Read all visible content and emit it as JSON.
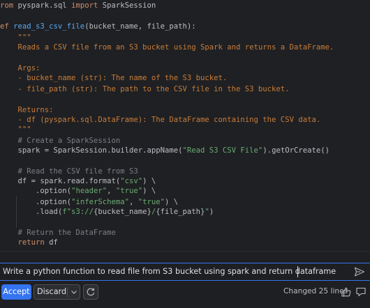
{
  "editor": {
    "lines": [
      [
        {
          "c": "kw",
          "t": "rom "
        },
        {
          "c": "id",
          "t": "pyspark.sql "
        },
        {
          "c": "kw",
          "t": "import "
        },
        {
          "c": "id",
          "t": "SparkSession"
        }
      ],
      [],
      [
        {
          "c": "kw",
          "t": "ef "
        },
        {
          "c": "fn",
          "t": "read_s3_csv_file"
        },
        {
          "c": "id",
          "t": "(bucket_name, file_path):"
        }
      ],
      [
        {
          "c": "doc",
          "t": "    \"\"\""
        }
      ],
      [
        {
          "c": "doc",
          "t": "    Reads a CSV file from an S3 bucket using Spark and returns a DataFrame."
        }
      ],
      [],
      [
        {
          "c": "doc",
          "t": "    Args:"
        }
      ],
      [
        {
          "c": "doc",
          "t": "    - bucket_name (str): The name of the S3 bucket."
        }
      ],
      [
        {
          "c": "doc",
          "t": "    - file_path (str): The path to the CSV file in the S3 bucket."
        }
      ],
      [],
      [
        {
          "c": "doc",
          "t": "    Returns:"
        }
      ],
      [
        {
          "c": "doc",
          "t": "    - df (pyspark.sql.DataFrame): The DataFrame containing the CSV data."
        }
      ],
      [
        {
          "c": "doc",
          "t": "    \"\"\""
        }
      ],
      [
        {
          "c": "cmt",
          "t": "    # Create a SparkSession"
        }
      ],
      [
        {
          "c": "id",
          "t": "    spark = SparkSession.builder.appName("
        },
        {
          "c": "str",
          "t": "\"Read S3 CSV File\""
        },
        {
          "c": "id",
          "t": ").getOrCreate()"
        }
      ],
      [],
      [
        {
          "c": "cmt",
          "t": "    # Read the CSV file from S3"
        }
      ],
      [
        {
          "c": "id",
          "t": "    df = spark.read.format("
        },
        {
          "c": "str",
          "t": "\"csv\""
        },
        {
          "c": "id",
          "t": ") \\"
        }
      ],
      [
        {
          "c": "id",
          "t": "        .option("
        },
        {
          "c": "str",
          "t": "\"header\""
        },
        {
          "c": "id",
          "t": ", "
        },
        {
          "c": "str",
          "t": "\"true\""
        },
        {
          "c": "id",
          "t": ") \\"
        }
      ],
      [
        {
          "c": "id",
          "t": "        .option("
        },
        {
          "c": "str",
          "t": "\"inferSchema\""
        },
        {
          "c": "id",
          "t": ", "
        },
        {
          "c": "str",
          "t": "\"true\""
        },
        {
          "c": "id",
          "t": ") \\"
        }
      ],
      [
        {
          "c": "id",
          "t": "        .load("
        },
        {
          "c": "str",
          "t": "f\"s3://"
        },
        {
          "c": "id",
          "t": "{bucket_name}"
        },
        {
          "c": "str",
          "t": "/"
        },
        {
          "c": "id",
          "t": "{file_path}"
        },
        {
          "c": "str",
          "t": "\""
        },
        {
          "c": "id",
          "t": ")"
        }
      ],
      [],
      [
        {
          "c": "cmt",
          "t": "    # Return the DataFrame"
        }
      ],
      [
        {
          "c": "kw",
          "t": "    return "
        },
        {
          "c": "id",
          "t": "df"
        }
      ]
    ]
  },
  "prompt": {
    "text": "Write a python function to read file from S3 bucket using spark and return dataframe"
  },
  "actions": {
    "accept_label": "Accept",
    "discard_label": "Discard",
    "changed_label": "Changed 25 lines"
  },
  "icons": {
    "send": "send-icon",
    "dropdown": "chevron-down-icon",
    "retry": "refresh-icon",
    "thumbs_up": "thumbs-up-icon",
    "feedback": "comment-icon"
  },
  "colors": {
    "accent": "#3574f0",
    "background": "#1e1f22"
  }
}
